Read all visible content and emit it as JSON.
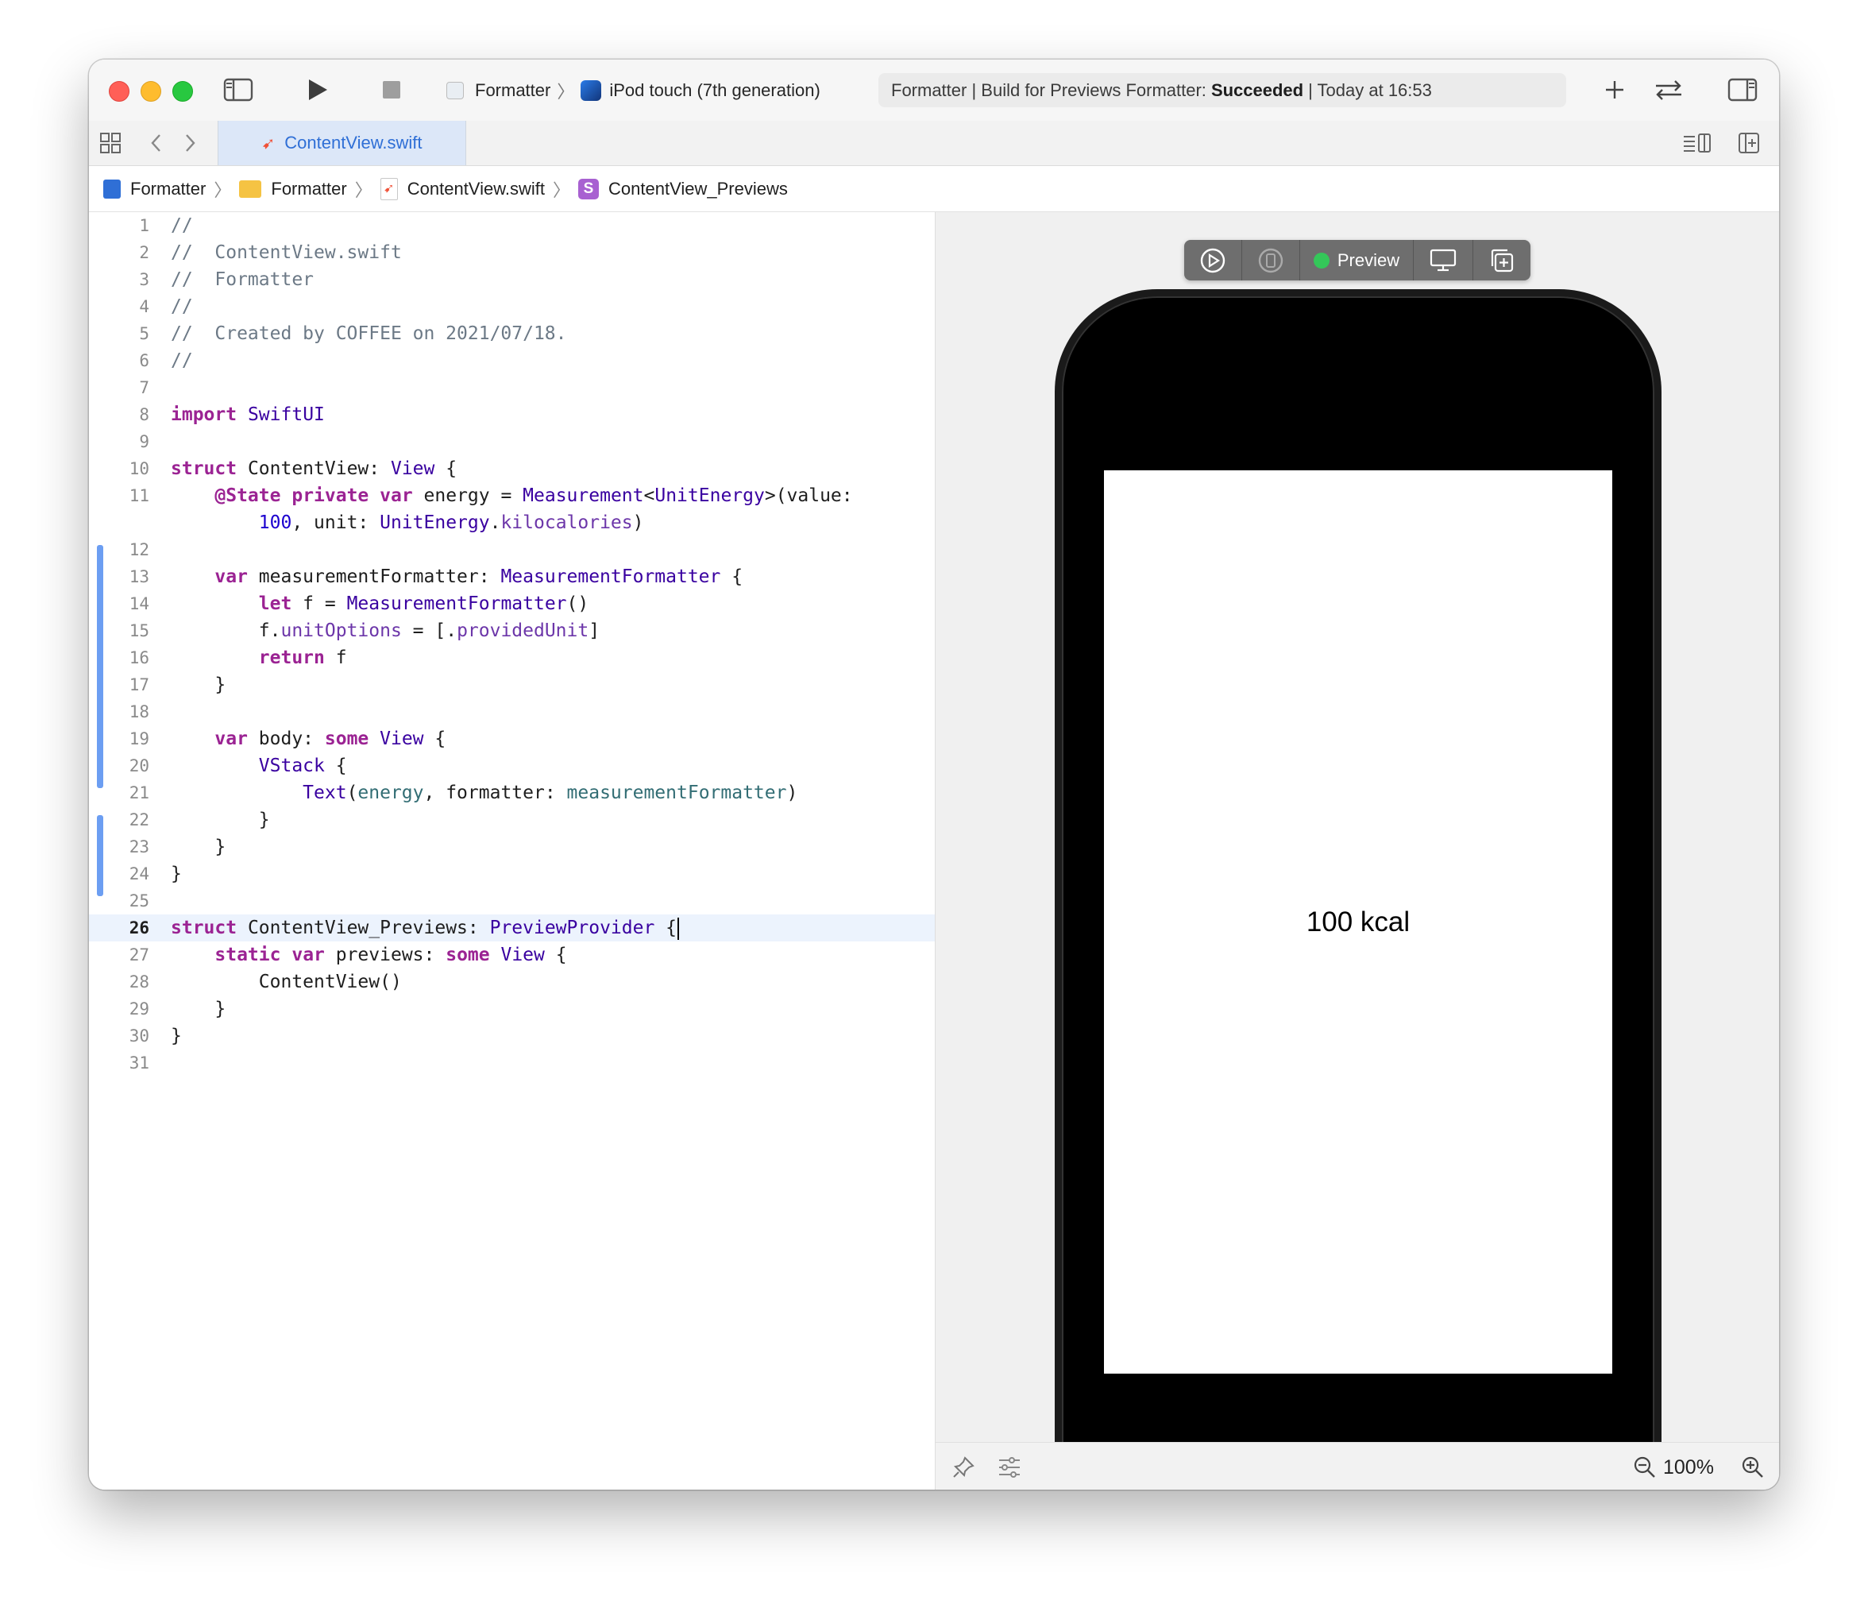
{
  "titlebar": {
    "scheme_project": "Formatter",
    "scheme_device": "iPod touch (7th generation)",
    "activity_prefix": "Formatter | Build for Previews Formatter:",
    "activity_status": "Succeeded",
    "activity_suffix": "| Today at 16:53"
  },
  "tabs": [
    {
      "label": "ContentView.swift",
      "active": true
    }
  ],
  "breadcrumb": [
    {
      "label": "Formatter",
      "icon": "project-icon"
    },
    {
      "label": "Formatter",
      "icon": "folder-icon"
    },
    {
      "label": "ContentView.swift",
      "icon": "swift-file-icon"
    },
    {
      "label": "ContentView_Previews",
      "icon": "struct-icon"
    }
  ],
  "editor": {
    "current_line": "26",
    "lines": [
      {
        "n": "1",
        "code": "//"
      },
      {
        "n": "2",
        "code": "//  ContentView.swift"
      },
      {
        "n": "3",
        "code": "//  Formatter"
      },
      {
        "n": "4",
        "code": "//"
      },
      {
        "n": "5",
        "code": "//  Created by COFFEE on 2021/07/18."
      },
      {
        "n": "6",
        "code": "//"
      },
      {
        "n": "7",
        "code": ""
      },
      {
        "n": "8",
        "code": "import SwiftUI"
      },
      {
        "n": "9",
        "code": ""
      },
      {
        "n": "10",
        "code": "struct ContentView: View {"
      },
      {
        "n": "11",
        "code": "    @State private var energy = Measurement<UnitEnergy>(value:"
      },
      {
        "n": "",
        "code": "        100, unit: UnitEnergy.kilocalories)"
      },
      {
        "n": "12",
        "code": ""
      },
      {
        "n": "13",
        "code": "    var measurementFormatter: MeasurementFormatter {"
      },
      {
        "n": "14",
        "code": "        let f = MeasurementFormatter()"
      },
      {
        "n": "15",
        "code": "        f.unitOptions = [.providedUnit]"
      },
      {
        "n": "16",
        "code": "        return f"
      },
      {
        "n": "17",
        "code": "    }"
      },
      {
        "n": "18",
        "code": ""
      },
      {
        "n": "19",
        "code": "    var body: some View {"
      },
      {
        "n": "20",
        "code": "        VStack {"
      },
      {
        "n": "21",
        "code": "            Text(energy, formatter: measurementFormatter)"
      },
      {
        "n": "22",
        "code": "        }"
      },
      {
        "n": "23",
        "code": "    }"
      },
      {
        "n": "24",
        "code": "}"
      },
      {
        "n": "25",
        "code": ""
      },
      {
        "n": "26",
        "code": "struct ContentView_Previews: PreviewProvider {"
      },
      {
        "n": "27",
        "code": "    static var previews: some View {"
      },
      {
        "n": "28",
        "code": "        ContentView()"
      },
      {
        "n": "29",
        "code": "    }"
      },
      {
        "n": "30",
        "code": "}"
      },
      {
        "n": "31",
        "code": ""
      }
    ]
  },
  "canvas": {
    "preview_label": "Preview",
    "preview_text": "100 kcal",
    "zoom": "100%"
  },
  "colors": {
    "close": "#ff5f57",
    "minimize": "#febc2e",
    "zoom": "#28c840",
    "accent": "#2f6fd6",
    "live_dot": "#34c759",
    "change_bar": "#6c9ef2"
  }
}
